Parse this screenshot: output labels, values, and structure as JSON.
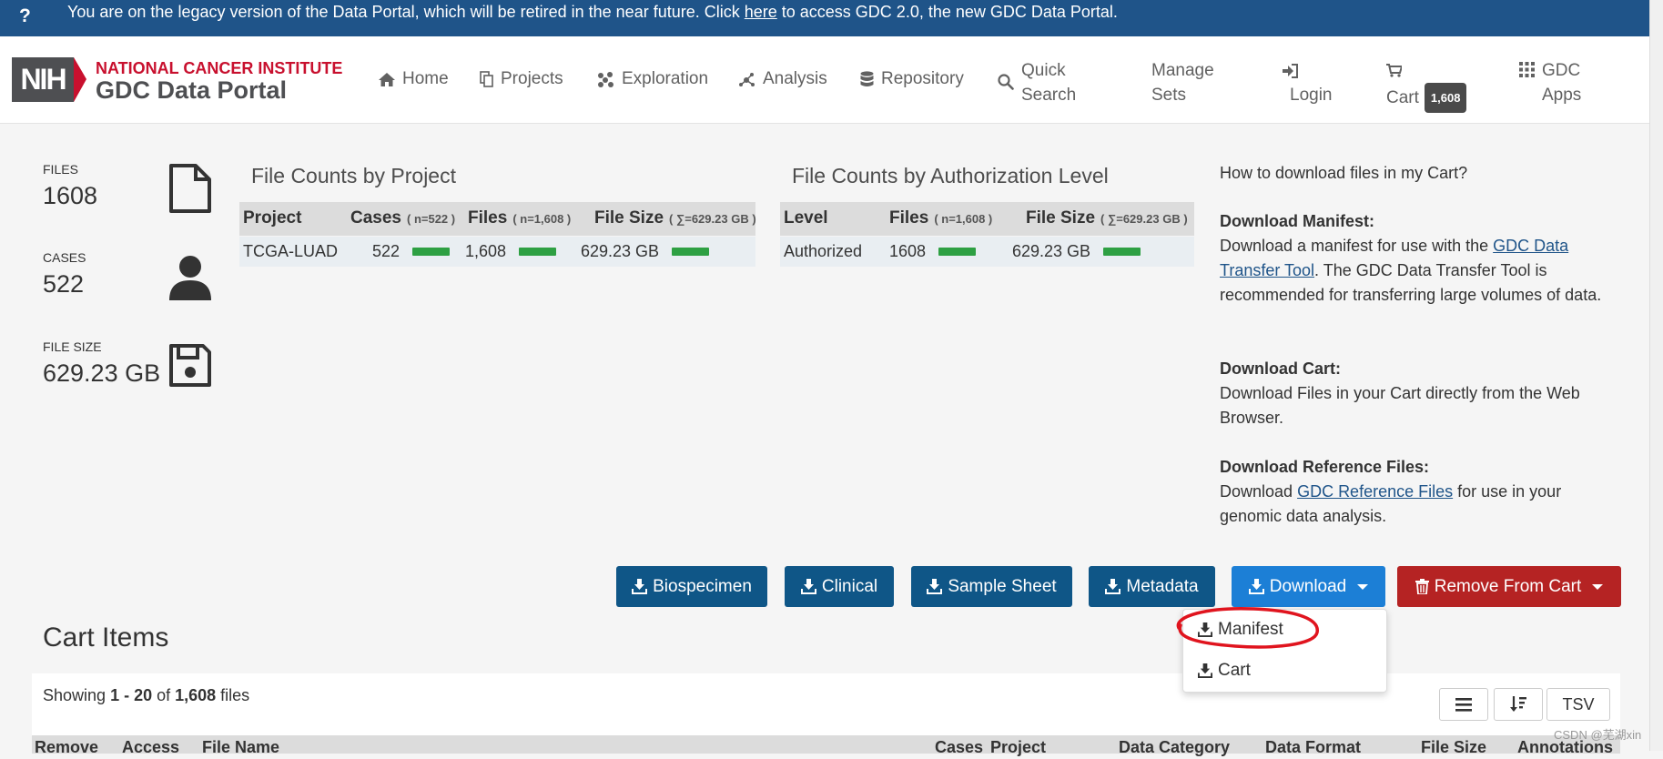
{
  "banner": {
    "icon": "?",
    "text_before": "You are on the legacy version of the Data Portal, which will be retired in the near future. Click ",
    "link": "here",
    "text_after": " to access GDC 2.0, the new GDC Data Portal."
  },
  "logo": {
    "nih": "NIH",
    "nci": "NATIONAL CANCER INSTITUTE",
    "portal": "GDC Data Portal"
  },
  "nav": {
    "home": "Home",
    "projects": "Projects",
    "exploration": "Exploration",
    "analysis": "Analysis",
    "repository": "Repository",
    "quick_search_1": "Quick",
    "quick_search_2": "Search",
    "manage_sets_1": "Manage",
    "manage_sets_2": "Sets",
    "login": "Login",
    "cart": "Cart",
    "cart_count": "1,608",
    "gdc_apps_1": "GDC",
    "gdc_apps_2": "Apps"
  },
  "summary": {
    "files_label": "FILES",
    "files_value": "1608",
    "cases_label": "CASES",
    "cases_value": "522",
    "size_label": "FILE SIZE",
    "size_value": "629.23 GB"
  },
  "project_table": {
    "title": "File Counts by Project",
    "headers": {
      "project": "Project",
      "cases": "Cases",
      "cases_n": "( n=522 )",
      "files": "Files",
      "files_n": "( n=1,608 )",
      "size": "File Size",
      "size_n": "( ∑=629.23 GB )"
    },
    "rows": [
      {
        "project": "TCGA-LUAD",
        "cases": "522",
        "files": "1,608",
        "size": "629.23 GB"
      }
    ]
  },
  "auth_table": {
    "title": "File Counts by Authorization Level",
    "headers": {
      "level": "Level",
      "files": "Files",
      "files_n": "( n=1,608 )",
      "size": "File Size",
      "size_n": "( ∑=629.23 GB )"
    },
    "rows": [
      {
        "level": "Authorized",
        "files": "1608",
        "size": "629.23 GB"
      }
    ]
  },
  "help": {
    "question": "How to download files in my Cart?",
    "manifest_title": "Download Manifest:",
    "manifest_pre": "Download a manifest for use with the ",
    "manifest_link": "GDC Data Transfer Tool",
    "manifest_post": ". The GDC Data Transfer Tool is recommended for transferring large volumes of data.",
    "cart_title": "Download Cart:",
    "cart_text": "Download Files in your Cart directly from the Web Browser.",
    "ref_title": "Download Reference Files:",
    "ref_pre": "Download ",
    "ref_link": "GDC Reference Files",
    "ref_post": " for use in your genomic data analysis."
  },
  "actions": {
    "biospecimen": "Biospecimen",
    "clinical": "Clinical",
    "sample_sheet": "Sample Sheet",
    "metadata": "Metadata",
    "download": "Download",
    "remove": "Remove From Cart"
  },
  "download_menu": {
    "manifest": "Manifest",
    "cart": "Cart"
  },
  "cart_items": {
    "title": "Cart Items",
    "showing_pre": "Showing ",
    "range": "1 - 20",
    "of": " of ",
    "total": "1,608",
    "unit": " files",
    "tsv": "TSV",
    "columns": [
      "Remove",
      "Access",
      "File Name",
      "Cases",
      "Project",
      "Data Category",
      "Data Format",
      "File Size",
      "Annotations"
    ]
  },
  "watermark": "CSDN @芜湖xin",
  "colors": {
    "banner": "#1f5489",
    "primary_button": "#0f5687",
    "download_button": "#1c7fd6",
    "remove_button": "#b52323",
    "bar": "#2ea043",
    "nih_red": "#c8102e"
  }
}
